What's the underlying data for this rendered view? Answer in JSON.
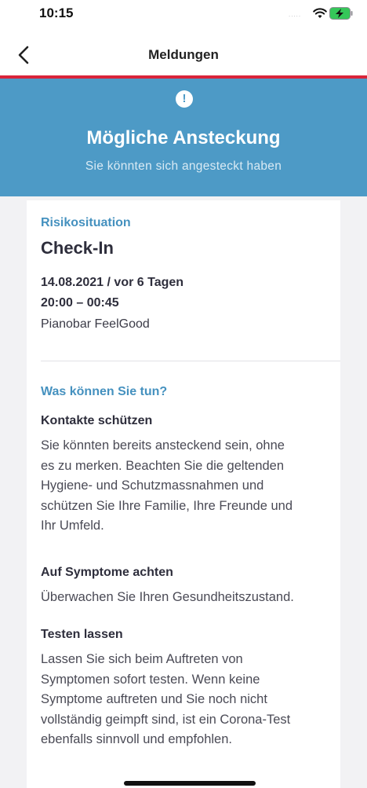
{
  "status_bar": {
    "time": "10:15",
    "signal": "....."
  },
  "nav": {
    "title": "Meldungen",
    "back_icon": "chevron-left-icon"
  },
  "banner": {
    "icon": "exclamation-icon",
    "icon_glyph": "!",
    "title": "Mögliche Ansteckung",
    "subtitle": "Sie könnten sich angesteckt haben",
    "color": "#4d9ac6"
  },
  "risk": {
    "label": "Risikosituation",
    "title": "Check-In",
    "date": "14.08.2021 / vor 6 Tagen",
    "time_range": "20:00 – 00:45",
    "venue": "Pianobar FeelGood"
  },
  "actions": {
    "heading": "Was können Sie tun?",
    "items": [
      {
        "title": "Kontakte schützen",
        "lines": [
          "Sie könnten bereits ansteckend sein, ohne",
          "es zu merken. Beachten Sie die geltenden",
          "Hygiene- und Schutzmassnahmen und",
          "schützen Sie Ihre Familie, Ihre Freunde und",
          "Ihr Umfeld."
        ]
      },
      {
        "title": "Auf Symptome achten",
        "lines": [
          "Überwachen Sie Ihren Gesundheitszustand."
        ]
      },
      {
        "title": "Testen lassen",
        "lines": [
          "Lassen Sie sich beim Auftreten von",
          "Symptomen sofort testen. Wenn keine",
          "Symptome auftreten und Sie noch nicht",
          "vollständig geimpft sind, ist ein Corona-Test",
          "ebenfalls sinnvoll und empfohlen."
        ]
      }
    ]
  },
  "colors": {
    "accent_red": "#d9243a",
    "link_blue": "#4591bf"
  }
}
